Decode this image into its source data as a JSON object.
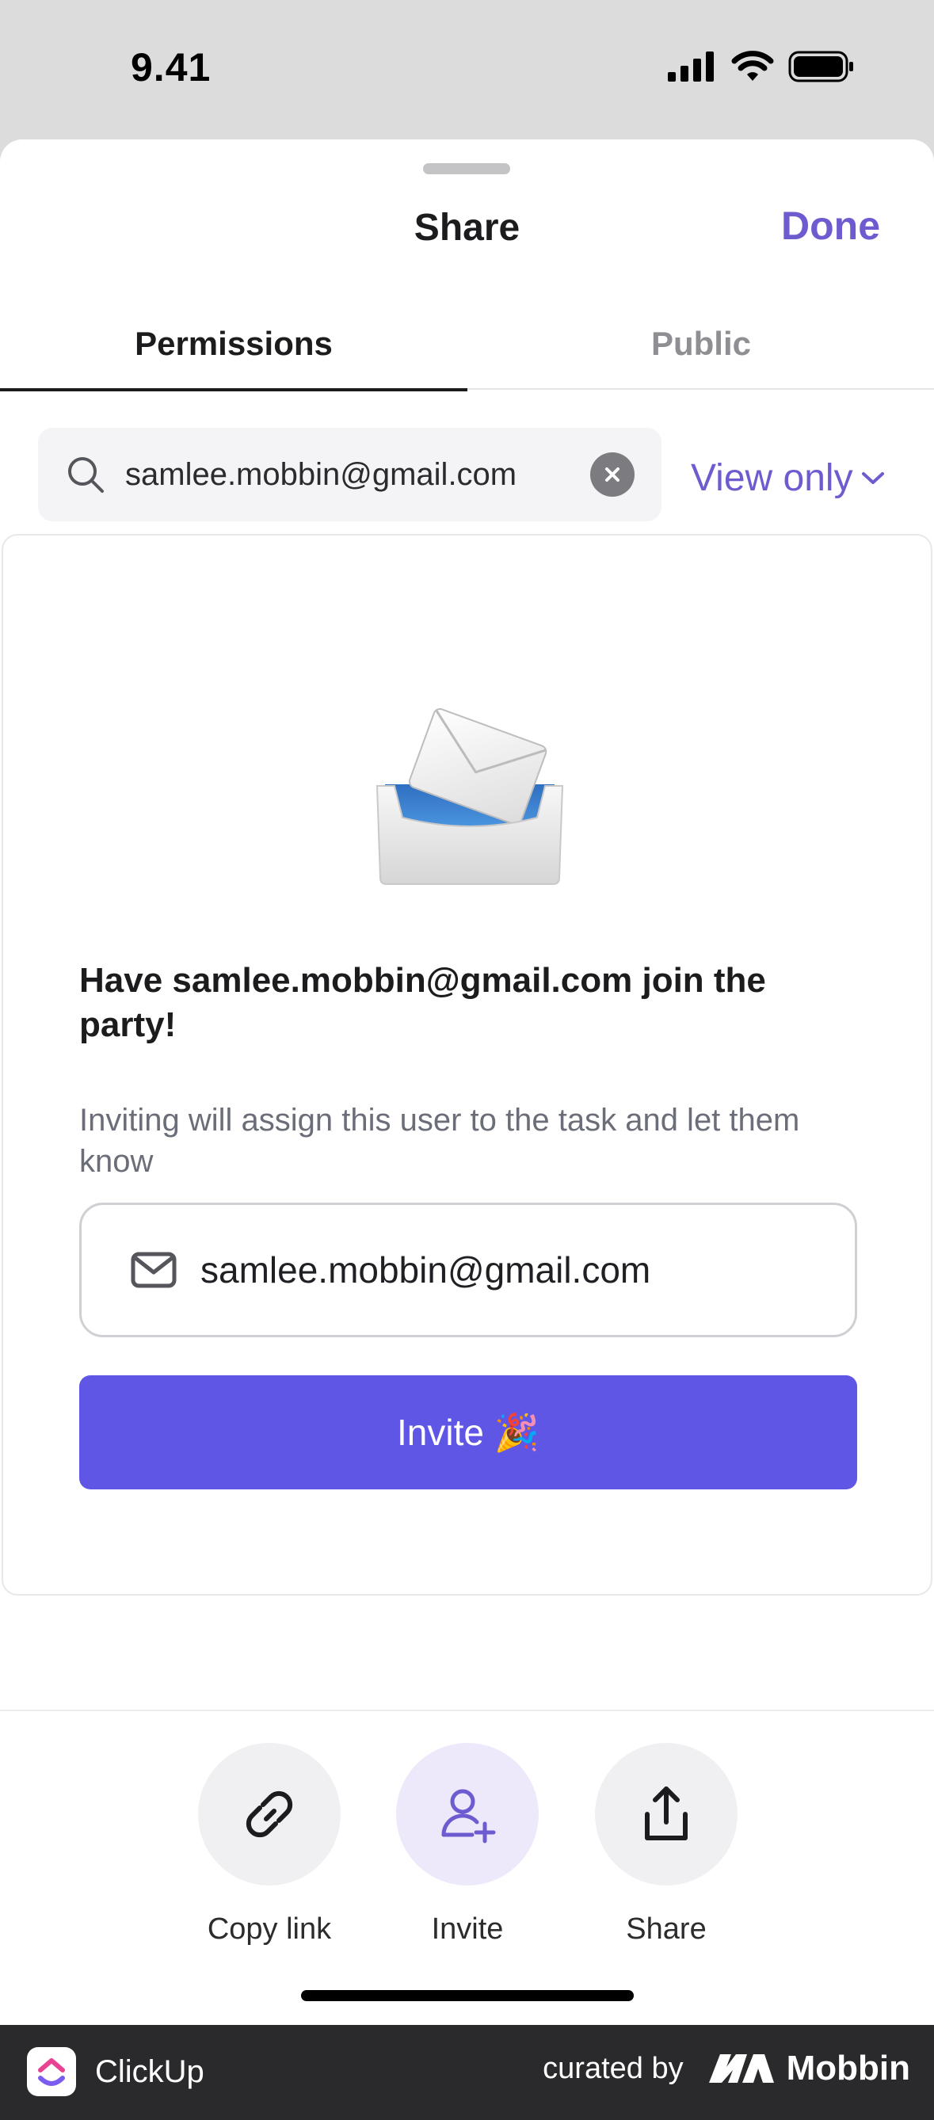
{
  "status_bar": {
    "time": "9.41"
  },
  "header": {
    "title": "Share",
    "done_label": "Done"
  },
  "tabs": [
    {
      "label": "Permissions",
      "active": true
    },
    {
      "label": "Public",
      "active": false
    }
  ],
  "search": {
    "value": "samlee.mobbin@gmail.com"
  },
  "permission": {
    "selected": "View only"
  },
  "invite_card": {
    "heading": "Have samlee.mobbin@gmail.com join the party!",
    "subtext": "Inviting will assign this user to the task and let them know",
    "email_value": "samlee.mobbin@gmail.com",
    "invite_label": "Invite 🎉"
  },
  "actions": [
    {
      "label": "Copy link",
      "icon": "link-icon"
    },
    {
      "label": "Invite",
      "icon": "user-plus-icon"
    },
    {
      "label": "Share",
      "icon": "share-icon"
    }
  ],
  "footer": {
    "app_name": "ClickUp",
    "curated_by": "curated by",
    "brand": "Mobbin"
  },
  "colors": {
    "accent": "#6d5bd0",
    "primary_button": "#5f56e6"
  }
}
